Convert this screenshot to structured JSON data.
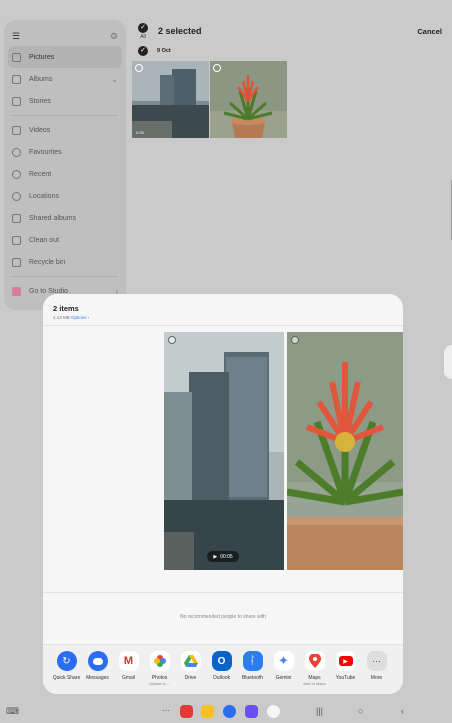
{
  "sidebar": {
    "items": [
      {
        "label": "Pictures"
      },
      {
        "label": "Albums"
      },
      {
        "label": "Stories"
      },
      {
        "label": "Videos"
      },
      {
        "label": "Favourites"
      },
      {
        "label": "Recent"
      },
      {
        "label": "Locations"
      },
      {
        "label": "Shared albums"
      },
      {
        "label": "Clean out"
      },
      {
        "label": "Recycle bin"
      },
      {
        "label": "Go to Studio"
      }
    ]
  },
  "topbar": {
    "all_label": "All",
    "selected_title": "2 selected",
    "cancel_label": "Cancel"
  },
  "date_group": "9 Oct",
  "thumbs": [
    {
      "badge": "0:05"
    }
  ],
  "share": {
    "title": "2 items",
    "size": "4.13 MB",
    "options_label": "Options",
    "video_duration": "00:05",
    "no_people": "No recommended people to share with",
    "apps": [
      {
        "label": "Quick Share",
        "sub": "",
        "color": "#2a6df0",
        "icon": "quick-share-icon"
      },
      {
        "label": "Messages",
        "sub": "",
        "color": "#ffffff",
        "icon": "messages-icon"
      },
      {
        "label": "Gmail",
        "sub": "",
        "color": "#ffffff",
        "icon": "gmail-icon"
      },
      {
        "label": "Photos",
        "sub": "Upload to ...",
        "color": "#ffffff",
        "icon": "photos-icon"
      },
      {
        "label": "Drive",
        "sub": "",
        "color": "#ffffff",
        "icon": "drive-icon"
      },
      {
        "label": "Outlook",
        "sub": "",
        "color": "#ffffff",
        "icon": "outlook-icon"
      },
      {
        "label": "Bluetooth",
        "sub": "",
        "color": "#2a7ef0",
        "icon": "bluetooth-icon"
      },
      {
        "label": "Gemini",
        "sub": "",
        "color": "#ffffff",
        "icon": "gemini-icon"
      },
      {
        "label": "Maps",
        "sub": "Add to Maps",
        "color": "#ffffff",
        "icon": "maps-icon"
      },
      {
        "label": "YouTube",
        "sub": "",
        "color": "#ffffff",
        "icon": "youtube-icon"
      },
      {
        "label": "More",
        "sub": "",
        "color": "#e0e0e0",
        "icon": "more-icon"
      }
    ]
  }
}
